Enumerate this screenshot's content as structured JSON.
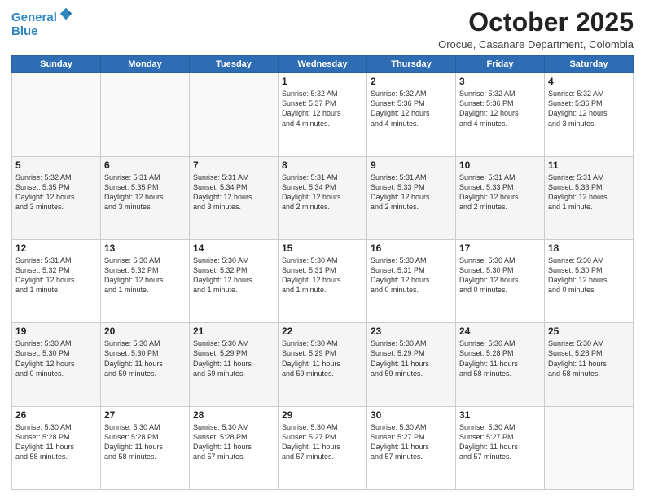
{
  "header": {
    "logo_line1": "General",
    "logo_line2": "Blue",
    "month": "October 2025",
    "location": "Orocue, Casanare Department, Colombia"
  },
  "weekdays": [
    "Sunday",
    "Monday",
    "Tuesday",
    "Wednesday",
    "Thursday",
    "Friday",
    "Saturday"
  ],
  "weeks": [
    [
      {
        "day": "",
        "info": ""
      },
      {
        "day": "",
        "info": ""
      },
      {
        "day": "",
        "info": ""
      },
      {
        "day": "1",
        "info": "Sunrise: 5:32 AM\nSunset: 5:37 PM\nDaylight: 12 hours\nand 4 minutes."
      },
      {
        "day": "2",
        "info": "Sunrise: 5:32 AM\nSunset: 5:36 PM\nDaylight: 12 hours\nand 4 minutes."
      },
      {
        "day": "3",
        "info": "Sunrise: 5:32 AM\nSunset: 5:36 PM\nDaylight: 12 hours\nand 4 minutes."
      },
      {
        "day": "4",
        "info": "Sunrise: 5:32 AM\nSunset: 5:36 PM\nDaylight: 12 hours\nand 3 minutes."
      }
    ],
    [
      {
        "day": "5",
        "info": "Sunrise: 5:32 AM\nSunset: 5:35 PM\nDaylight: 12 hours\nand 3 minutes."
      },
      {
        "day": "6",
        "info": "Sunrise: 5:31 AM\nSunset: 5:35 PM\nDaylight: 12 hours\nand 3 minutes."
      },
      {
        "day": "7",
        "info": "Sunrise: 5:31 AM\nSunset: 5:34 PM\nDaylight: 12 hours\nand 3 minutes."
      },
      {
        "day": "8",
        "info": "Sunrise: 5:31 AM\nSunset: 5:34 PM\nDaylight: 12 hours\nand 2 minutes."
      },
      {
        "day": "9",
        "info": "Sunrise: 5:31 AM\nSunset: 5:33 PM\nDaylight: 12 hours\nand 2 minutes."
      },
      {
        "day": "10",
        "info": "Sunrise: 5:31 AM\nSunset: 5:33 PM\nDaylight: 12 hours\nand 2 minutes."
      },
      {
        "day": "11",
        "info": "Sunrise: 5:31 AM\nSunset: 5:33 PM\nDaylight: 12 hours\nand 1 minute."
      }
    ],
    [
      {
        "day": "12",
        "info": "Sunrise: 5:31 AM\nSunset: 5:32 PM\nDaylight: 12 hours\nand 1 minute."
      },
      {
        "day": "13",
        "info": "Sunrise: 5:30 AM\nSunset: 5:32 PM\nDaylight: 12 hours\nand 1 minute."
      },
      {
        "day": "14",
        "info": "Sunrise: 5:30 AM\nSunset: 5:32 PM\nDaylight: 12 hours\nand 1 minute."
      },
      {
        "day": "15",
        "info": "Sunrise: 5:30 AM\nSunset: 5:31 PM\nDaylight: 12 hours\nand 1 minute."
      },
      {
        "day": "16",
        "info": "Sunrise: 5:30 AM\nSunset: 5:31 PM\nDaylight: 12 hours\nand 0 minutes."
      },
      {
        "day": "17",
        "info": "Sunrise: 5:30 AM\nSunset: 5:30 PM\nDaylight: 12 hours\nand 0 minutes."
      },
      {
        "day": "18",
        "info": "Sunrise: 5:30 AM\nSunset: 5:30 PM\nDaylight: 12 hours\nand 0 minutes."
      }
    ],
    [
      {
        "day": "19",
        "info": "Sunrise: 5:30 AM\nSunset: 5:30 PM\nDaylight: 12 hours\nand 0 minutes."
      },
      {
        "day": "20",
        "info": "Sunrise: 5:30 AM\nSunset: 5:30 PM\nDaylight: 11 hours\nand 59 minutes."
      },
      {
        "day": "21",
        "info": "Sunrise: 5:30 AM\nSunset: 5:29 PM\nDaylight: 11 hours\nand 59 minutes."
      },
      {
        "day": "22",
        "info": "Sunrise: 5:30 AM\nSunset: 5:29 PM\nDaylight: 11 hours\nand 59 minutes."
      },
      {
        "day": "23",
        "info": "Sunrise: 5:30 AM\nSunset: 5:29 PM\nDaylight: 11 hours\nand 59 minutes."
      },
      {
        "day": "24",
        "info": "Sunrise: 5:30 AM\nSunset: 5:28 PM\nDaylight: 11 hours\nand 58 minutes."
      },
      {
        "day": "25",
        "info": "Sunrise: 5:30 AM\nSunset: 5:28 PM\nDaylight: 11 hours\nand 58 minutes."
      }
    ],
    [
      {
        "day": "26",
        "info": "Sunrise: 5:30 AM\nSunset: 5:28 PM\nDaylight: 11 hours\nand 58 minutes."
      },
      {
        "day": "27",
        "info": "Sunrise: 5:30 AM\nSunset: 5:28 PM\nDaylight: 11 hours\nand 58 minutes."
      },
      {
        "day": "28",
        "info": "Sunrise: 5:30 AM\nSunset: 5:28 PM\nDaylight: 11 hours\nand 57 minutes."
      },
      {
        "day": "29",
        "info": "Sunrise: 5:30 AM\nSunset: 5:27 PM\nDaylight: 11 hours\nand 57 minutes."
      },
      {
        "day": "30",
        "info": "Sunrise: 5:30 AM\nSunset: 5:27 PM\nDaylight: 11 hours\nand 57 minutes."
      },
      {
        "day": "31",
        "info": "Sunrise: 5:30 AM\nSunset: 5:27 PM\nDaylight: 11 hours\nand 57 minutes."
      },
      {
        "day": "",
        "info": ""
      }
    ]
  ]
}
